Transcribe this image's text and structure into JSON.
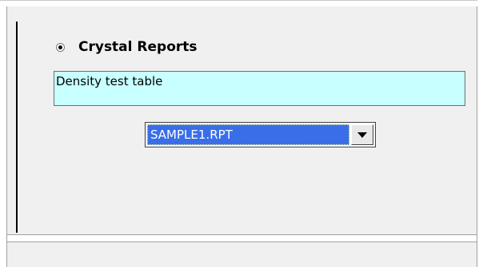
{
  "report_type": {
    "radio_label": "Crystal Reports",
    "selected": true
  },
  "description": {
    "text": "Density test table",
    "background_color": "#c8ffff"
  },
  "report_file": {
    "selected_value": "SAMPLE1.RPT",
    "highlight_color": "#3a6ee8"
  },
  "icons": {
    "dropdown": "chevron-down-icon",
    "radio": "radio-selected-icon"
  }
}
